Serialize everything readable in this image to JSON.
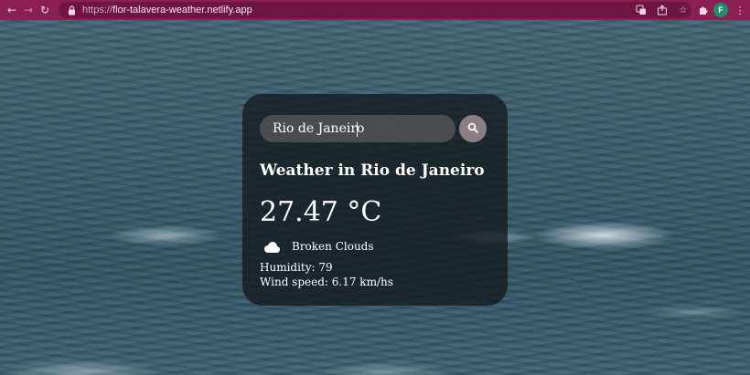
{
  "browser": {
    "url_scheme": "https://",
    "url_host": "flor-talavera-weather.netlify.app",
    "profile_initial": "F",
    "colors": {
      "chrome": "#8c1f52",
      "omnibox": "#6e1641",
      "avatar": "#1a8f6a"
    }
  },
  "weather": {
    "search_value": "Rio de Janeiro",
    "title": "Weather in Rio de Janeiro",
    "temperature": "27.47 °C",
    "condition_icon": "cloud-icon",
    "condition": "Broken Clouds",
    "humidity": "Humidity: 79",
    "wind": "Wind speed: 6.17 km/hs",
    "colors": {
      "card": "#14181c",
      "search_button": "#8a7f83"
    }
  }
}
